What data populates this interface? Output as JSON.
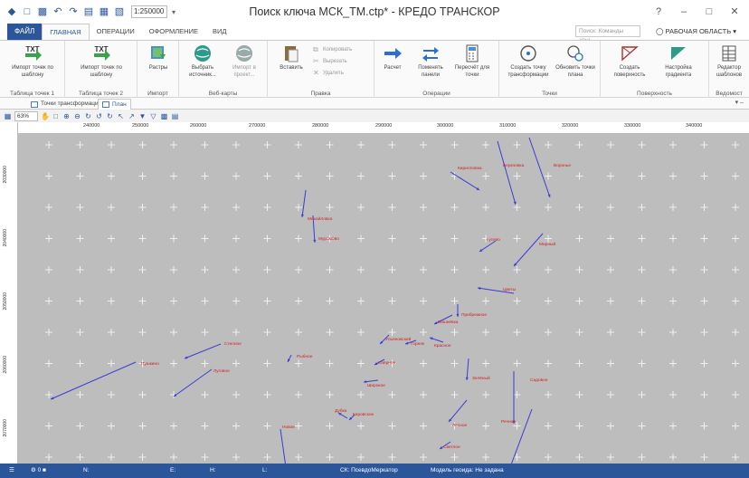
{
  "app": {
    "title": "Поиск ключа МСК_ТМ.ctp* - КРЕДО ТРАНСКОР",
    "zoom_scale": "1:250000"
  },
  "ribbon_tabs": [
    {
      "label": "ФАЙЛ",
      "active": false
    },
    {
      "label": "ГЛАВНАЯ",
      "active": true
    },
    {
      "label": "ОПЕРАЦИИ",
      "active": false
    },
    {
      "label": "ОФОРМЛЕНИЕ",
      "active": false
    },
    {
      "label": "ВИД",
      "active": false
    }
  ],
  "search_commands": {
    "placeholder": "Поиск: Команды (Ctrl..."
  },
  "workspace": {
    "label": "РАБОЧАЯ ОБЛАСТЬ"
  },
  "ribbon_groups": [
    {
      "title": "Таблица точек 1",
      "buttons": [
        {
          "label": "Импорт точек по шаблону",
          "icon": "txt-import-icon"
        }
      ]
    },
    {
      "title": "Таблица точек 2",
      "buttons": [
        {
          "label": "Импорт точек по шаблону",
          "icon": "txt-import-icon"
        }
      ]
    },
    {
      "title": "Импорт",
      "buttons": [
        {
          "label": "Растры",
          "icon": "raster-icon"
        }
      ]
    },
    {
      "title": "Веб-карты",
      "buttons": [
        {
          "label": "Выбрать источник...",
          "icon": "globe-icon"
        },
        {
          "label": "Импорт в проект...",
          "icon": "globe-import-icon"
        }
      ]
    },
    {
      "title": "Правка",
      "buttons": [
        {
          "label": "Вставить",
          "icon": "paste-icon"
        }
      ],
      "small": [
        "Копировать",
        "Вырезать",
        "Удалить"
      ]
    },
    {
      "title": "Операции",
      "buttons": [
        {
          "label": "Расчет",
          "icon": "arrow-right-icon"
        },
        {
          "label": "Поменять панели",
          "icon": "swap-icon"
        },
        {
          "label": "Пересчёт для точки",
          "icon": "calculator-icon"
        }
      ]
    },
    {
      "title": "Точки",
      "buttons": [
        {
          "label": "Создать точку трансформации",
          "icon": "point-add-icon"
        },
        {
          "label": "Обновить точки плана",
          "icon": "point-refresh-icon"
        }
      ]
    },
    {
      "title": "Поверхность",
      "buttons": [
        {
          "label": "Создать поверхность",
          "icon": "surface-icon"
        },
        {
          "label": "Настройка градиента",
          "icon": "gradient-icon"
        }
      ]
    },
    {
      "title": "Ведомост",
      "buttons": [
        {
          "label": "Редактор шаблонов",
          "icon": "table-icon"
        }
      ]
    }
  ],
  "doc_tabs": [
    {
      "label": "Точки трансформации",
      "active": false
    },
    {
      "label": "План",
      "active": true
    }
  ],
  "map_toolbar": {
    "zoom": "63%"
  },
  "ruler": {
    "top": [
      "240000",
      "250000",
      "260000",
      "270000",
      "280000",
      "290000",
      "300000",
      "310000",
      "320000",
      "330000",
      "340000"
    ],
    "left": [
      "2030000",
      "2040000",
      "2050000",
      "2060000",
      "2070000"
    ]
  },
  "map_points": [
    {
      "label": "Кирилловка"
    },
    {
      "label": "Березовка"
    },
    {
      "label": "Воронье"
    },
    {
      "label": "Михайловка"
    },
    {
      "label": "Муромово"
    },
    {
      "label": "Гусево"
    },
    {
      "label": "Мирный"
    },
    {
      "label": "Цветы"
    },
    {
      "label": "Прибрежное"
    },
    {
      "label": "Вишнёвка"
    },
    {
      "label": "Красное"
    },
    {
      "label": "Ульяновский"
    },
    {
      "label": "Горняк"
    },
    {
      "label": "Степное"
    },
    {
      "label": "Пушкино"
    },
    {
      "label": "Луговое"
    },
    {
      "label": "Рыбное"
    },
    {
      "label": "Озёрное"
    },
    {
      "label": "Широкое"
    },
    {
      "label": "Кировское"
    },
    {
      "label": "Дубки"
    },
    {
      "label": "Зелёный"
    },
    {
      "label": "Речное"
    },
    {
      "label": "Садовое"
    },
    {
      "label": "Светлое"
    },
    {
      "label": "Лесное"
    },
    {
      "label": "Новое"
    }
  ],
  "statusbar": {
    "n_label": "N:",
    "e_label": "E:",
    "h_label": "H:",
    "l_label": "L:",
    "cs": "СК: ПсевдоМеркатор",
    "geoid": "Модель геоида: Не задана"
  },
  "colors": {
    "accent": "#2b579a",
    "map_bg": "#bdbdbd",
    "vector": "#3b3bd6",
    "label": "#d32020",
    "grid_cross": "#f0f0f0"
  }
}
